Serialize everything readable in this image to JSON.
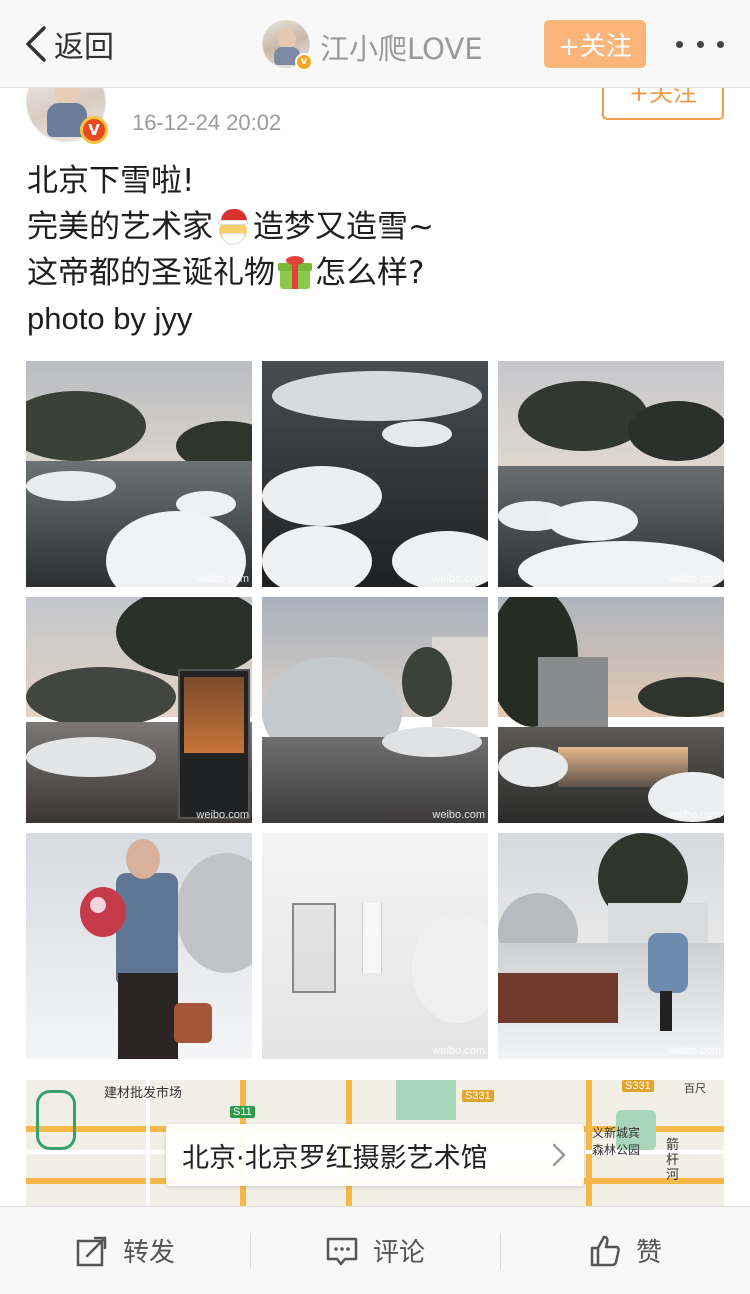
{
  "nav": {
    "back_label": "返回",
    "username": "江小爬LOVE",
    "follow_label": "+关注"
  },
  "post": {
    "time": "16-12-24 20:02",
    "follow_label": "+关注",
    "lines": [
      "北京下雪啦!",
      "完美的艺术家",
      "造梦又造雪~",
      "这帝都的圣诞礼物",
      "怎么样?",
      "photo by jyy"
    ],
    "emoji": [
      "santa-emoji",
      "gift-emoji"
    ]
  },
  "photos": {
    "count": 9,
    "watermark": "weibo.com"
  },
  "map": {
    "location_label": "北京·北京罗红摄影艺术馆",
    "labels": {
      "building_market": "建材批发市场",
      "road_s11": "S11",
      "road_s331_a": "S331",
      "road_s331_b": "S331",
      "park": "义新城宾 森林公园",
      "river": "箭杆河",
      "dist": "百尺"
    }
  },
  "toolbar": {
    "repost_label": "转发",
    "comment_label": "评论",
    "like_label": "赞"
  },
  "colors": {
    "follow_bg": "#fbb57b",
    "follow_outline": "#f39c4a",
    "text": "#1e1e1e",
    "muted": "#9b9b9b"
  }
}
